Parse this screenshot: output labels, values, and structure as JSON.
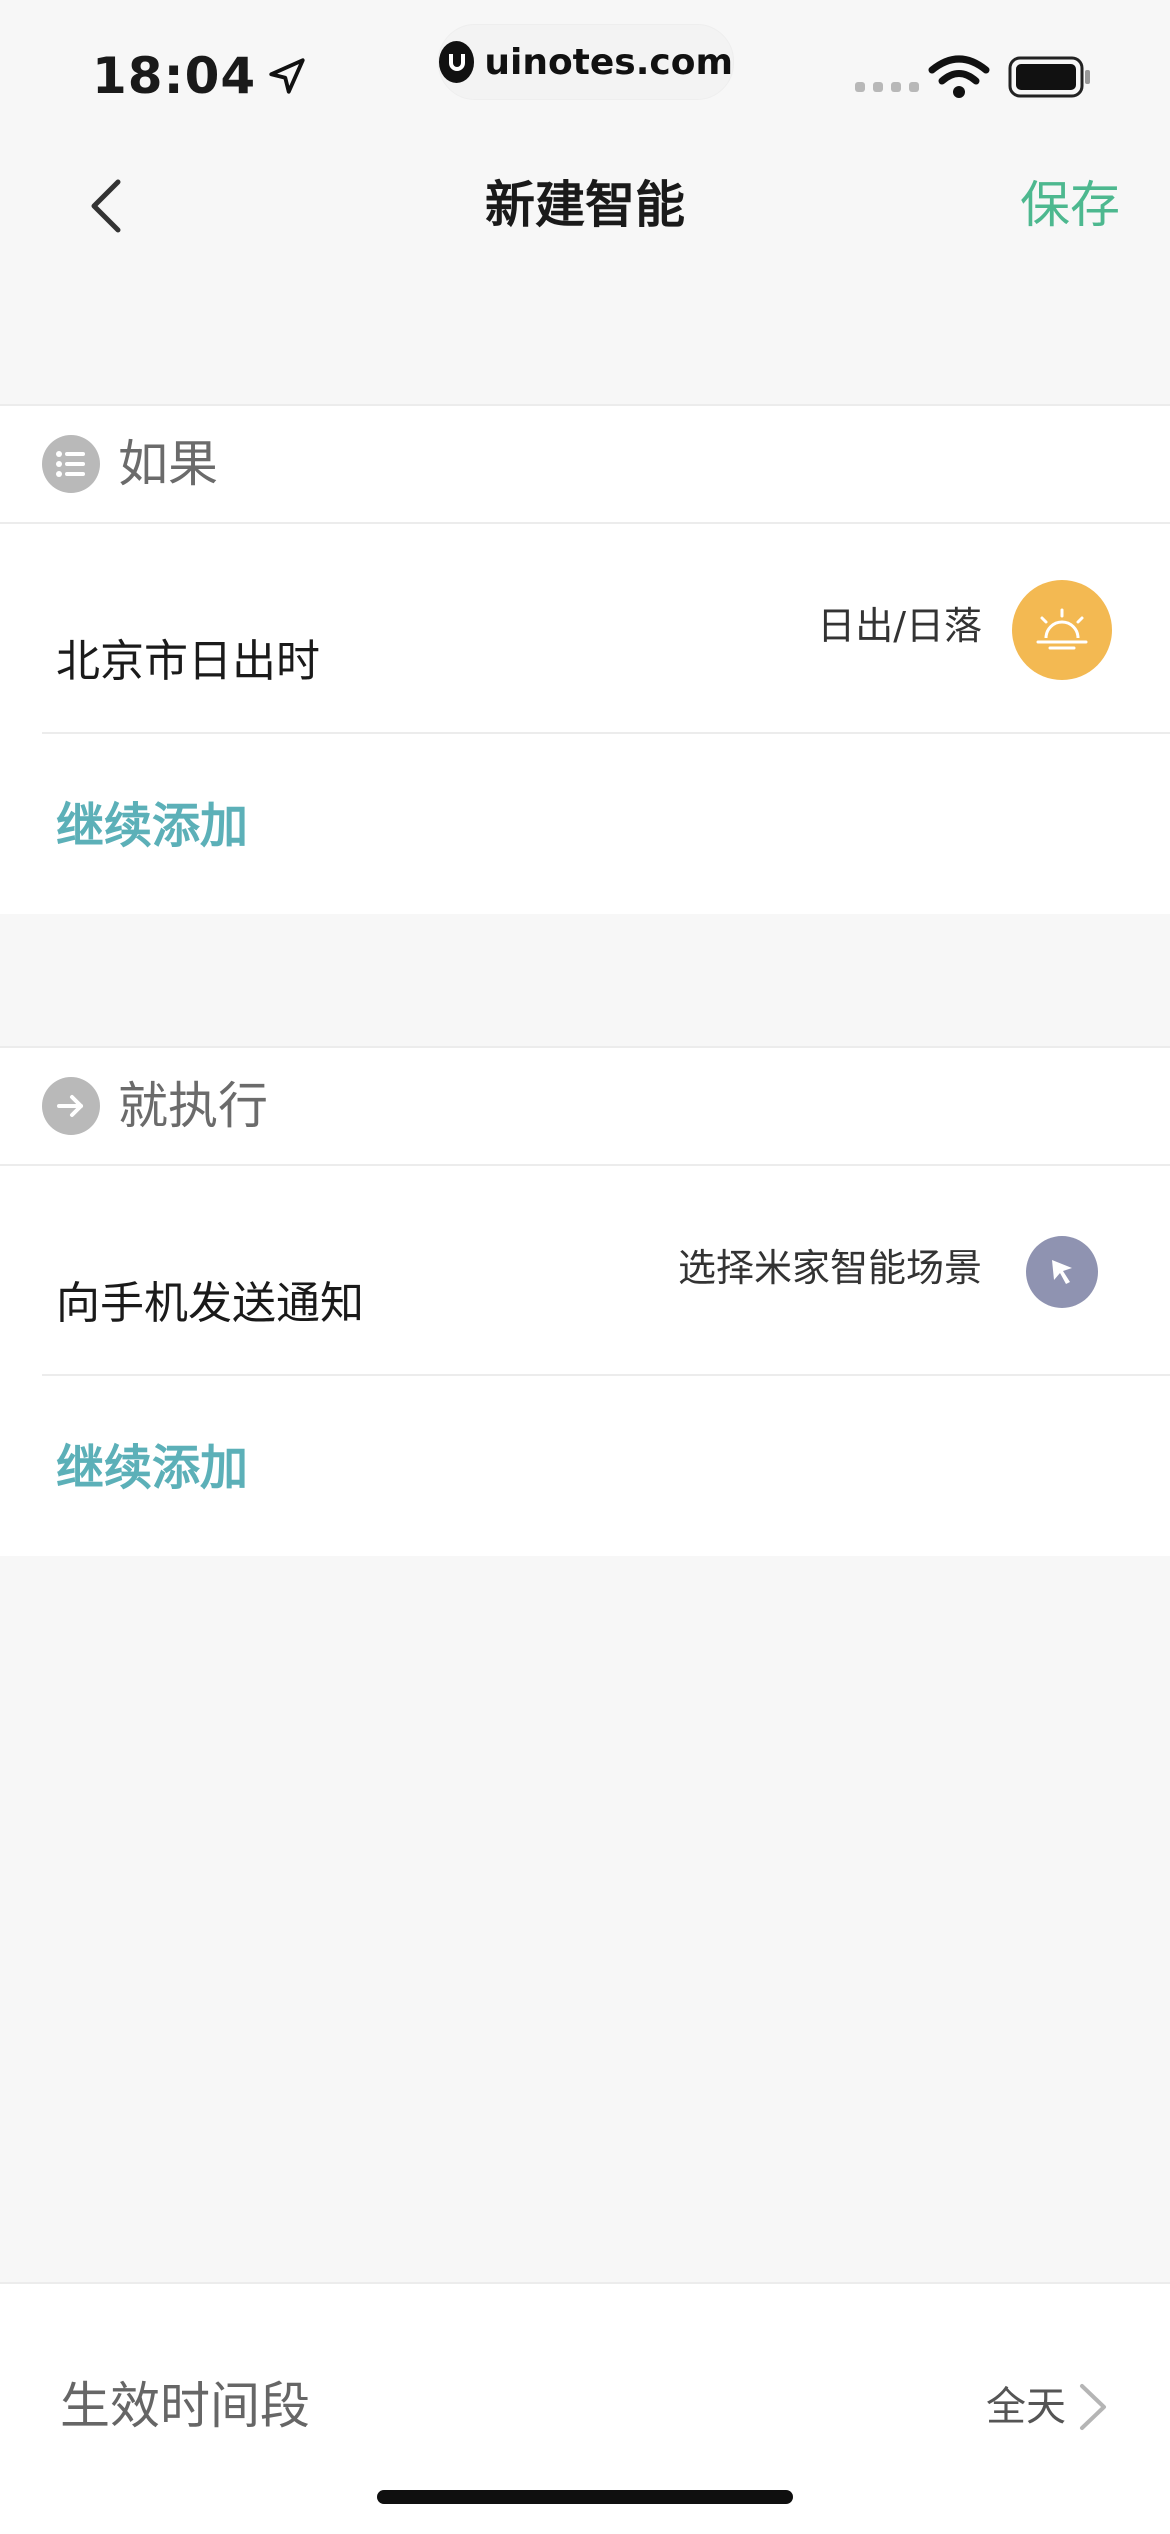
{
  "status_bar": {
    "time": "18:04",
    "watermark": "uinotes.com"
  },
  "nav": {
    "title": "新建智能",
    "save_label": "保存"
  },
  "if_section": {
    "title": "如果",
    "condition": {
      "label": "北京市日出时",
      "type": "日出/日落"
    },
    "add_label": "继续添加"
  },
  "then_section": {
    "title": "就执行",
    "action": {
      "label": "向手机发送通知",
      "type": "选择米家智能场景"
    },
    "add_label": "继续添加"
  },
  "effective_period": {
    "label": "生效时间段",
    "value": "全天"
  },
  "colors": {
    "accent_green": "#4db88f",
    "link_teal": "#5cb0b8",
    "sun_orange": "#f3b952",
    "scene_purple": "#8f93b1"
  }
}
